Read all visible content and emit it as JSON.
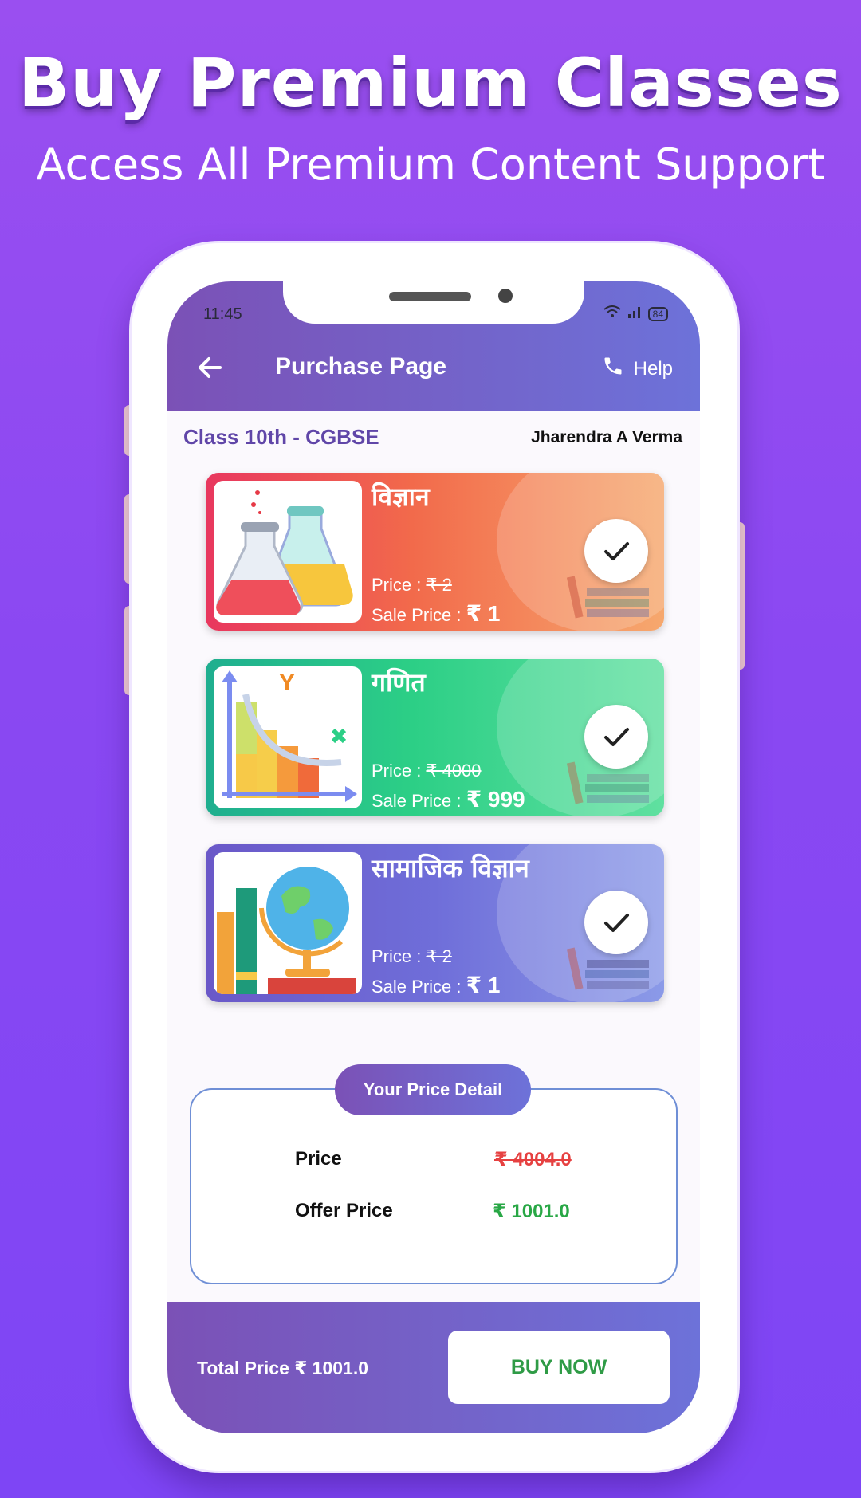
{
  "promo": {
    "headline": "Buy Premium Classes",
    "subline": "Access All Premium Content Support"
  },
  "status_bar": {
    "time": "11:45",
    "battery": "84"
  },
  "app_bar": {
    "title": "Purchase Page",
    "help_label": "Help"
  },
  "info": {
    "class_label": "Class 10th - CGBSE",
    "user_name": "Jharendra A Verma"
  },
  "subjects": [
    {
      "name": "विज्ञान",
      "price_label": "Price : ",
      "price": "₹ 2",
      "sale_label": "Sale Price : ",
      "sale_price": "₹ 1",
      "selected": true
    },
    {
      "name": "गणित",
      "price_label": "Price : ",
      "price": "₹ 4000",
      "sale_label": "Sale Price : ",
      "sale_price": "₹ 999",
      "selected": true
    },
    {
      "name": "सामाजिक विज्ञान",
      "price_label": "Price : ",
      "price": "₹ 2",
      "sale_label": "Sale Price : ",
      "sale_price": "₹ 1",
      "selected": true
    }
  ],
  "price_detail": {
    "heading": "Your Price Detail",
    "price_label": "Price",
    "price_value": "₹ 4004.0",
    "offer_label": "Offer Price",
    "offer_value": "₹ 1001.0"
  },
  "footer": {
    "total": "Total Price ₹ 1001.0",
    "buy_label": "BUY NOW"
  },
  "colors": {
    "accent": "#7b51b6",
    "offer_green": "#28a745",
    "strike_red": "#e64141"
  }
}
